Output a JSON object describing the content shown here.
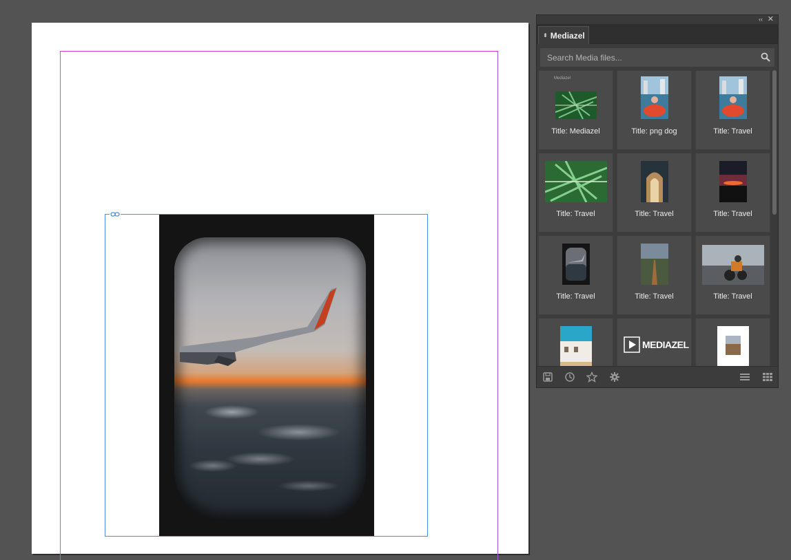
{
  "panel": {
    "tab_label": "Mediazel",
    "collapse_glyph": "‹‹",
    "close_glyph": "✕",
    "search": {
      "placeholder": "Search Media files..."
    },
    "items": [
      {
        "title": "Title: Mediazel",
        "thumb_caption": "Mediazel",
        "icon": "palm-leaf-thumbnail"
      },
      {
        "title": "Title: png dog",
        "icon": "kayak-city-thumbnail"
      },
      {
        "title": "Title: Travel",
        "icon": "kayak-city-thumbnail"
      },
      {
        "title": "Title: Travel",
        "icon": "palm-leaf-thumbnail"
      },
      {
        "title": "Title: Travel",
        "icon": "arch-corridor-thumbnail"
      },
      {
        "title": "Title: Travel",
        "icon": "sunset-thumbnail"
      },
      {
        "title": "Title: Travel",
        "icon": "airplane-window-thumbnail"
      },
      {
        "title": "Title: Travel",
        "icon": "road-thumbnail"
      },
      {
        "title": "Title: Travel",
        "icon": "motorcycle-thumbnail"
      },
      {
        "title": "",
        "icon": "building-thumbnail"
      },
      {
        "title": "",
        "logo_text": "MEDIAZEL",
        "icon": "mediazel-logo-thumbnail"
      },
      {
        "title": "",
        "icon": "framed-road-thumbnail"
      }
    ],
    "toolbar": [
      "save-icon",
      "history-icon",
      "star-icon",
      "gear-icon",
      "list-view-icon",
      "grid-view-icon"
    ]
  },
  "colors": {
    "pasteboard": "#535353",
    "panel_bg": "#3c3c3c",
    "cell_bg": "#4a4a4a",
    "frame_selection": "#4a8ee8",
    "margin_guide": "#d63ad6"
  }
}
